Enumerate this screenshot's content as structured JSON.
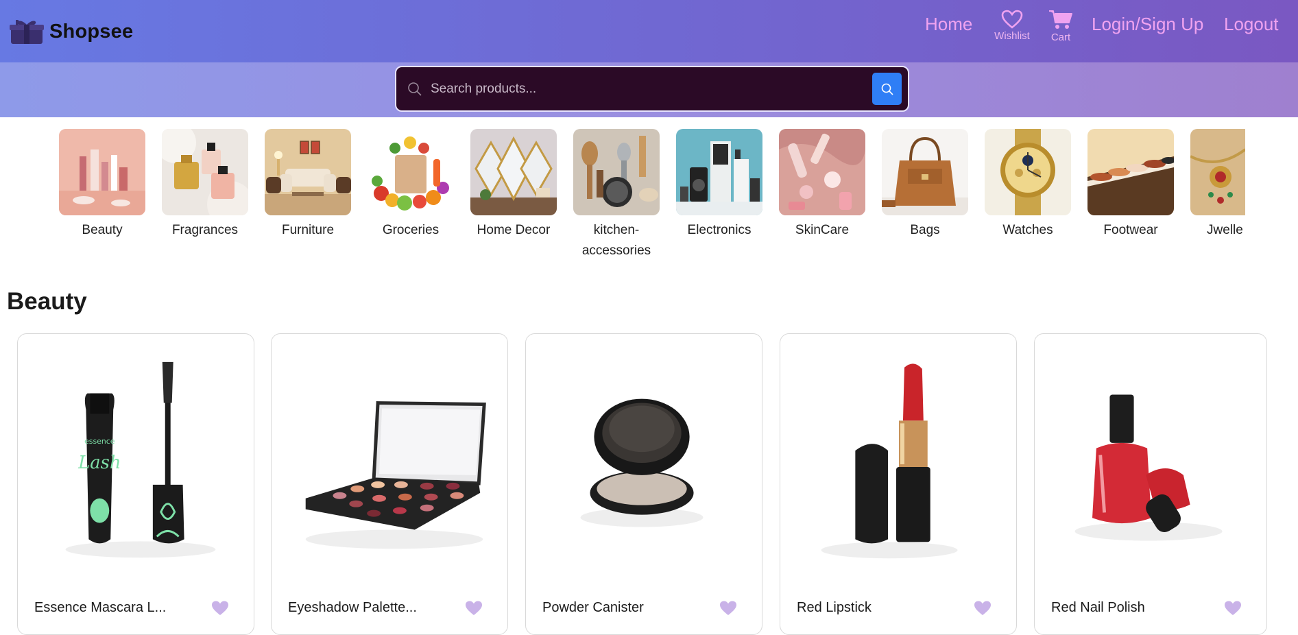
{
  "header": {
    "brand": "Shopsee",
    "nav": {
      "home": "Home",
      "wishlist": "Wishlist",
      "cart": "Cart",
      "login": "Login/Sign Up",
      "logout": "Logout"
    }
  },
  "search": {
    "placeholder": "Search products..."
  },
  "categories": [
    {
      "label": "Beauty",
      "icon": "beauty-products-image"
    },
    {
      "label": "Fragrances",
      "icon": "perfume-image"
    },
    {
      "label": "Furniture",
      "icon": "sofa-image"
    },
    {
      "label": "Groceries",
      "icon": "grocery-bag-image"
    },
    {
      "label": "Home Decor",
      "icon": "mirror-decor-image"
    },
    {
      "label": "kitchen-accessories",
      "icon": "kitchen-tools-image"
    },
    {
      "label": "Electronics",
      "icon": "electronics-image"
    },
    {
      "label": "SkinCare",
      "icon": "skincare-image"
    },
    {
      "label": "Bags",
      "icon": "handbag-image"
    },
    {
      "label": "Watches",
      "icon": "watch-image"
    },
    {
      "label": "Footwear",
      "icon": "shoes-image"
    },
    {
      "label": "Jwelle",
      "icon": "jewellery-image"
    }
  ],
  "section": {
    "title": "Beauty"
  },
  "products": [
    {
      "name": "Essence Mascara L...",
      "icon": "mascara-image"
    },
    {
      "name": "Eyeshadow Palette...",
      "icon": "eyeshadow-palette-image"
    },
    {
      "name": "Powder Canister",
      "icon": "powder-canister-image"
    },
    {
      "name": "Red Lipstick",
      "icon": "lipstick-image"
    },
    {
      "name": "Red Nail Polish",
      "icon": "nail-polish-image"
    }
  ],
  "colors": {
    "nav_link": "#f0a3f0",
    "search_button": "#2f7ef6",
    "search_box": "#2b0a26",
    "heart": "#c9b2e8"
  }
}
